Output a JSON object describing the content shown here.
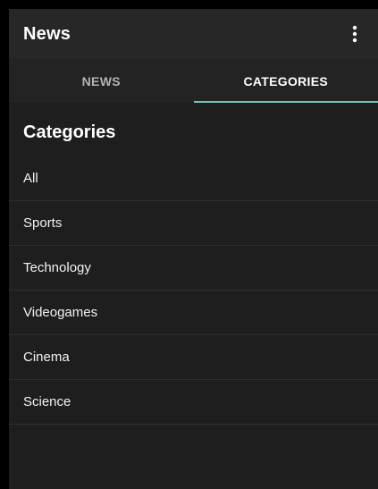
{
  "appbar": {
    "title": "News",
    "menu_icon": "more-vert-icon"
  },
  "tabs": [
    {
      "label": "NEWS",
      "active": false
    },
    {
      "label": "CATEGORIES",
      "active": true
    }
  ],
  "colors": {
    "background": "#1e1e1e",
    "appbar": "#272727",
    "tab_indicator": "#7fbfb3"
  },
  "categories": {
    "title": "Categories",
    "items": [
      {
        "label": "All"
      },
      {
        "label": "Sports"
      },
      {
        "label": "Technology"
      },
      {
        "label": "Videogames"
      },
      {
        "label": "Cinema"
      },
      {
        "label": "Science"
      }
    ]
  }
}
